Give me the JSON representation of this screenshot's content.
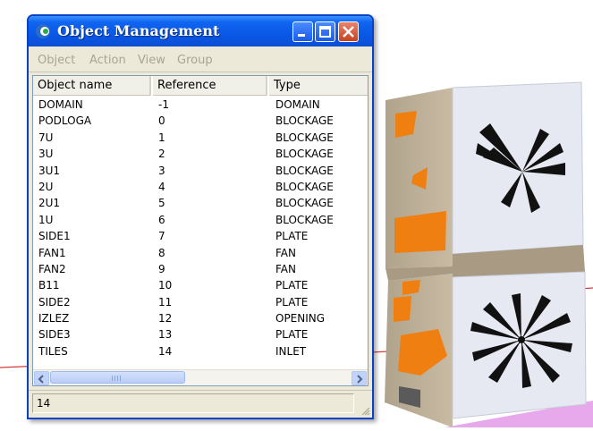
{
  "window": {
    "title": "Object Management",
    "menu": [
      "Object",
      "Action",
      "View",
      "Group"
    ],
    "columns": [
      "Object name",
      "Reference",
      "Type"
    ],
    "rows": [
      [
        "DOMAIN",
        "-1",
        "DOMAIN"
      ],
      [
        "PODLOGA",
        "0",
        "BLOCKAGE"
      ],
      [
        "7U",
        "1",
        "BLOCKAGE"
      ],
      [
        "3U",
        "2",
        "BLOCKAGE"
      ],
      [
        "3U1",
        "3",
        "BLOCKAGE"
      ],
      [
        "2U",
        "4",
        "BLOCKAGE"
      ],
      [
        "2U1",
        "5",
        "BLOCKAGE"
      ],
      [
        "1U",
        "6",
        "BLOCKAGE"
      ],
      [
        "SIDE1",
        "7",
        "PLATE"
      ],
      [
        "FAN1",
        "8",
        "FAN"
      ],
      [
        "FAN2",
        "9",
        "FAN"
      ],
      [
        "B11",
        "10",
        "PLATE"
      ],
      [
        "SIDE2",
        "11",
        "PLATE"
      ],
      [
        "IZLEZ",
        "12",
        "OPENING"
      ],
      [
        "SIDE3",
        "13",
        "PLATE"
      ],
      [
        "TILES",
        "14",
        "INLET"
      ]
    ],
    "status": "14"
  },
  "colors": {
    "titlebar": "#0a58e6",
    "menu_disabled": "#a7a593",
    "model_wall": "#c2b39b",
    "model_opening": "#f07f12",
    "model_fan_panel": "#e6e9f2",
    "floor_line": "#d63a3a",
    "floor_tile": "#e7a8ec"
  },
  "icons": [
    "app-icon",
    "minimize-icon",
    "maximize-icon",
    "close-icon",
    "scroll-left-icon",
    "scroll-right-icon",
    "resize-grip-icon"
  ]
}
